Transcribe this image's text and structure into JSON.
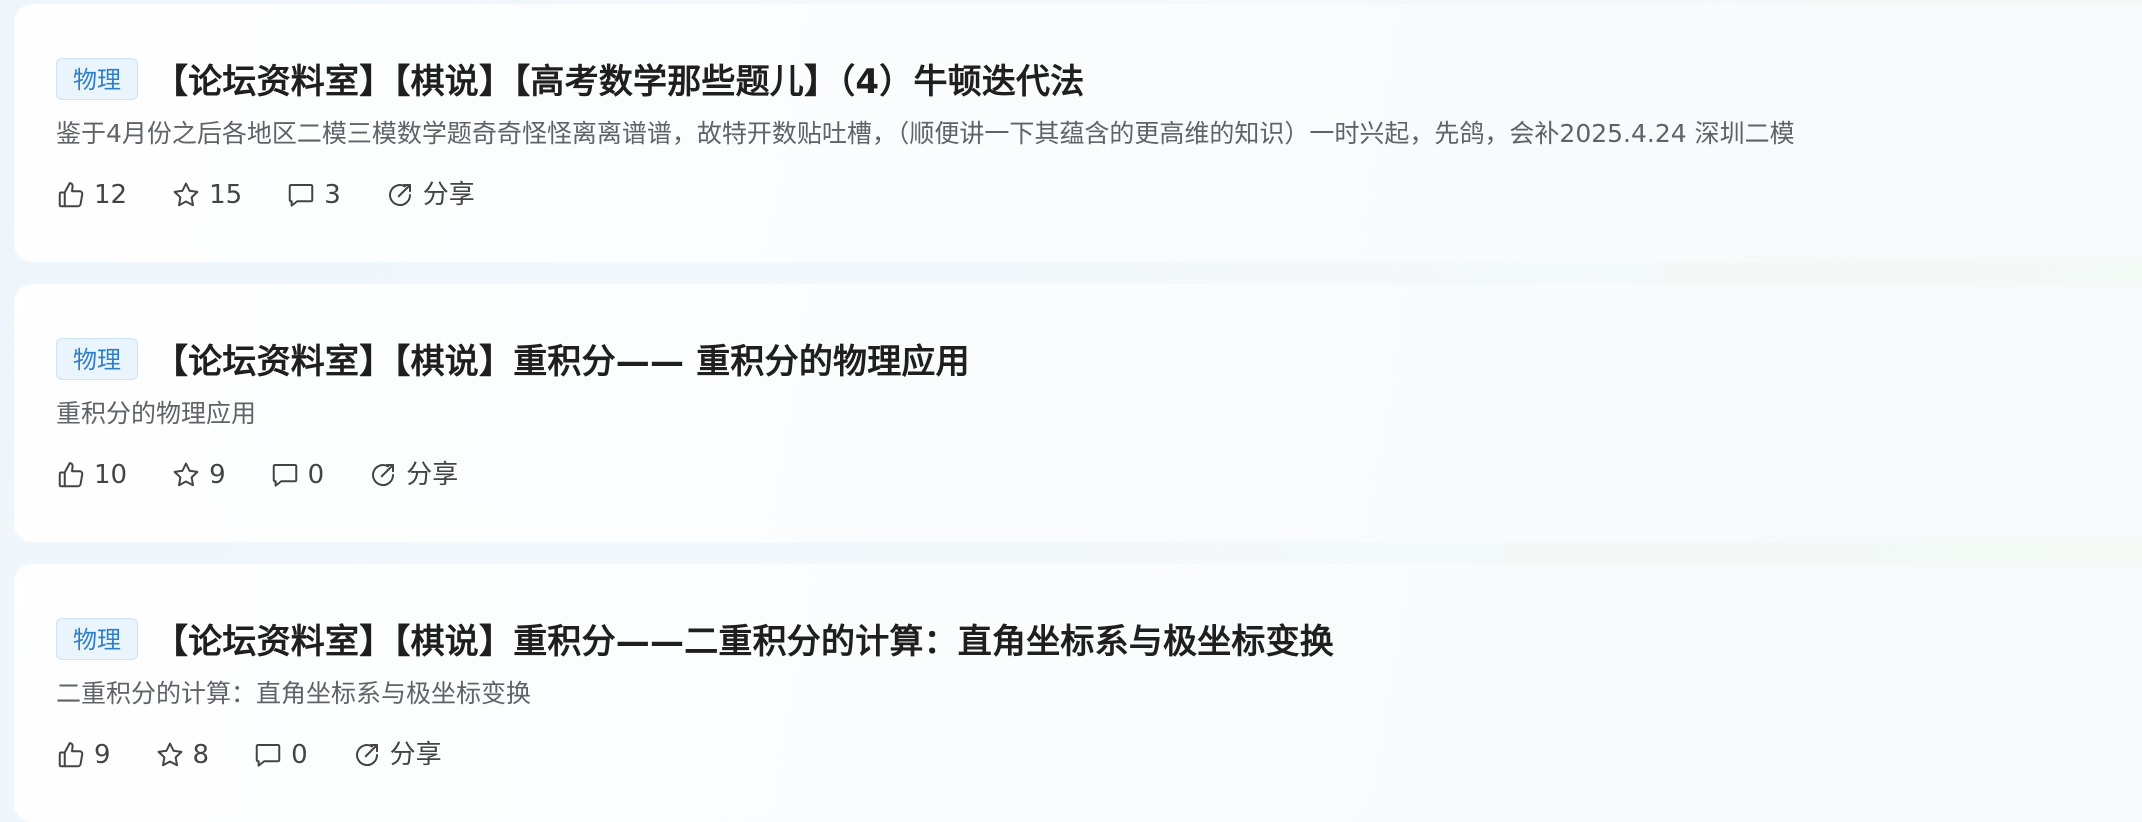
{
  "posts": [
    {
      "tag": "物理",
      "title": "【论坛资料室】【棋说】【高考数学那些题儿】（4）牛顿迭代法",
      "summary": "鉴于4月份之后各地区二模三模数学题奇奇怪怪离离谱谱，故特开数贴吐槽，（顺便讲一下其蕴含的更高维的知识）一时兴起，先鸽，会补2025.4.24 深圳二模",
      "likes": "12",
      "stars": "15",
      "comments": "3",
      "share_label": "分享"
    },
    {
      "tag": "物理",
      "title": "【论坛资料室】【棋说】重积分—— 重积分的物理应用",
      "summary": "重积分的物理应用",
      "likes": "10",
      "stars": "9",
      "comments": "0",
      "share_label": "分享"
    },
    {
      "tag": "物理",
      "title": "【论坛资料室】【棋说】重积分——二重积分的计算：直角坐标系与极坐标变换",
      "summary": "二重积分的计算：直角坐标系与极坐标变换",
      "likes": "9",
      "stars": "8",
      "comments": "0",
      "share_label": "分享"
    }
  ],
  "icons": {
    "like": "thumbs-up-icon",
    "star": "star-icon",
    "comment": "comment-icon",
    "share": "share-icon"
  },
  "colors": {
    "tag_text": "#2f7fc4",
    "tag_bg": "#e9f4fc",
    "title": "#1f1f1f",
    "summary": "#5f6368"
  }
}
